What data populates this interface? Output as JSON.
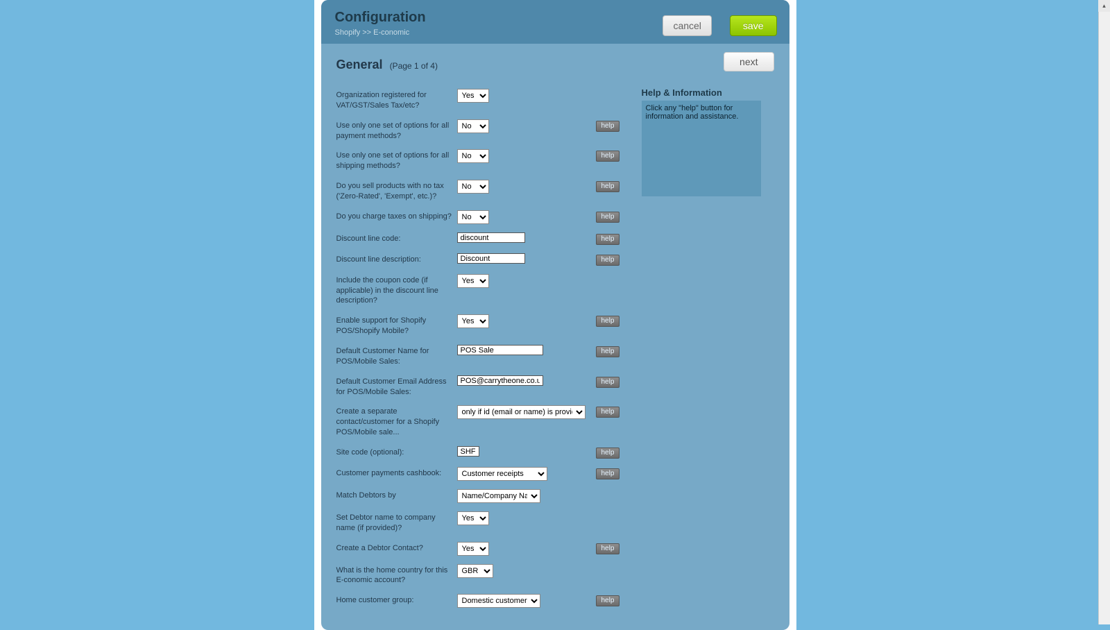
{
  "header": {
    "title": "Configuration",
    "breadcrumb": "Shopify >> E-conomic",
    "cancel_label": "cancel",
    "save_label": "save"
  },
  "section": {
    "title": "General",
    "page_indicator": "(Page 1 of 4)",
    "next_label": "next"
  },
  "help_panel": {
    "title": "Help & Information",
    "text": "Click any \"help\" button for information and assistance."
  },
  "help_btn_label": "help",
  "rows": {
    "r0": {
      "label": "Organization registered for VAT/GST/Sales Tax/etc?",
      "value": "Yes"
    },
    "r1": {
      "label": "Use only one set of options for all payment methods?",
      "value": "No"
    },
    "r2": {
      "label": "Use only one set of options for all shipping methods?",
      "value": "No"
    },
    "r3": {
      "label": "Do you sell products with no tax ('Zero-Rated', 'Exempt', etc.)?",
      "value": "No"
    },
    "r4": {
      "label": "Do you charge taxes on shipping?",
      "value": "No"
    },
    "r5": {
      "label": "Discount line code:",
      "value": "discount"
    },
    "r6": {
      "label": "Discount line description:",
      "value": "Discount"
    },
    "r7": {
      "label": "Include the coupon code (if applicable) in the discount line description?",
      "value": "Yes"
    },
    "r8": {
      "label": "Enable support for Shopify POS/Shopify Mobile?",
      "value": "Yes"
    },
    "r9": {
      "label": "Default Customer Name for POS/Mobile Sales:",
      "value": "POS Sale"
    },
    "r10": {
      "label": "Default Customer Email Address for POS/Mobile Sales:",
      "value": "POS@carrytheone.co.uk"
    },
    "r11": {
      "label": "Create a separate contact/customer for a Shopify POS/Mobile sale...",
      "value": "only if id (email or name) is provided"
    },
    "r12": {
      "label": "Site code (optional):",
      "value": "SHF"
    },
    "r13": {
      "label": "Customer payments cashbook:",
      "value": "Customer receipts"
    },
    "r14": {
      "label": "Match Debtors by",
      "value": "Name/Company Name"
    },
    "r15": {
      "label": "Set Debtor name to company name (if provided)?",
      "value": "Yes"
    },
    "r16": {
      "label": "Create a Debtor Contact?",
      "value": "Yes"
    },
    "r17": {
      "label": "What is the home country for this E-conomic account?",
      "value": "GBR"
    },
    "r18": {
      "label": "Home customer group:",
      "value": "Domestic customers"
    }
  }
}
